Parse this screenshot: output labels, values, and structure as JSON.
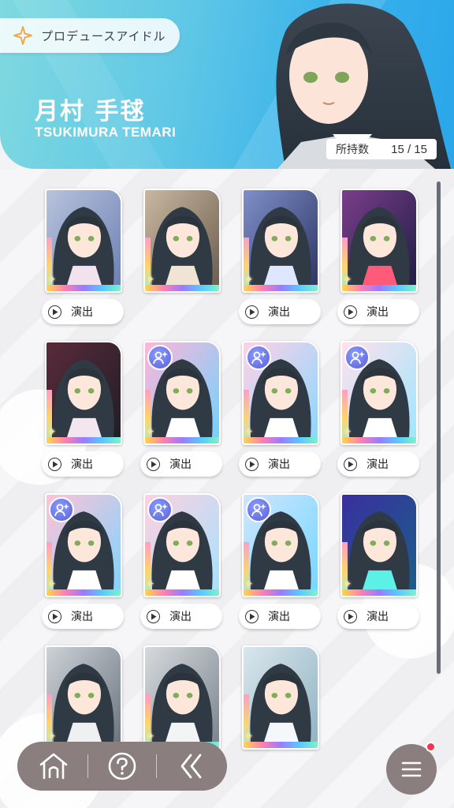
{
  "header": {
    "produce_label": "プロデュースアイドル",
    "name_jp": "月村 手毬",
    "name_en": "TSUKIMURA TEMARI",
    "owned_label": "所持数",
    "owned_count": "15 / 15"
  },
  "cards": [
    {
      "id": 1,
      "play_label": "演出",
      "badge": false
    },
    {
      "id": 2,
      "play_label": "",
      "badge": false
    },
    {
      "id": 3,
      "play_label": "演出",
      "badge": false
    },
    {
      "id": 4,
      "play_label": "演出",
      "badge": false
    },
    {
      "id": 5,
      "play_label": "演出",
      "badge": false
    },
    {
      "id": 6,
      "play_label": "演出",
      "badge": true
    },
    {
      "id": 7,
      "play_label": "演出",
      "badge": true
    },
    {
      "id": 8,
      "play_label": "演出",
      "badge": true
    },
    {
      "id": 9,
      "play_label": "演出",
      "badge": true
    },
    {
      "id": 10,
      "play_label": "演出",
      "badge": true
    },
    {
      "id": 11,
      "play_label": "演出",
      "badge": true
    },
    {
      "id": 12,
      "play_label": "演出",
      "badge": false
    },
    {
      "id": 13,
      "play_label": "",
      "badge": false
    },
    {
      "id": 14,
      "play_label": "",
      "badge": false
    },
    {
      "id": 15,
      "play_label": "",
      "badge": false
    }
  ],
  "bottom_nav": {
    "home_icon": "home-icon",
    "help_icon": "help-icon",
    "back_icon": "back-icon",
    "menu_icon": "menu-icon"
  },
  "colors": {
    "header_start": "#7fd9e0",
    "header_end": "#2aa6ea",
    "nav_bg": "#8a7e7e",
    "notification": "#f5364a"
  }
}
